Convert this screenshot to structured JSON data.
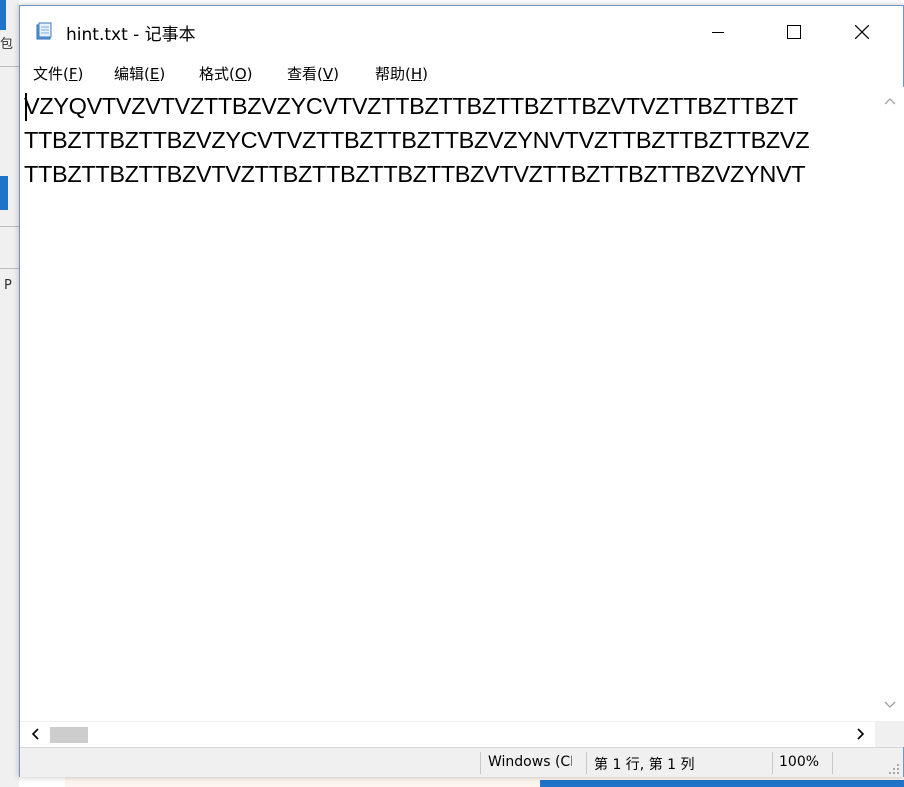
{
  "window": {
    "title": "hint.txt - 记事本",
    "controls": {
      "minimize": "minimize",
      "maximize": "maximize",
      "close": "close"
    }
  },
  "menu": [
    {
      "label": "文件(",
      "key": "F",
      "suffix": ")"
    },
    {
      "label": "编辑(",
      "key": "E",
      "suffix": ")"
    },
    {
      "label": "格式(",
      "key": "O",
      "suffix": ")"
    },
    {
      "label": "查看(",
      "key": "V",
      "suffix": ")"
    },
    {
      "label": "帮助(",
      "key": "H",
      "suffix": ")"
    }
  ],
  "editor": {
    "lines": [
      "VZYQVTVZVTVZTTBZVZYCVTVZTTBZTTBZTTBZTTBZVTVZTTBZTTBZT",
      "TTBZTTBZTTBZVZYCVTVZTTBZTTBZTTBZVZYNVTVZTTBZTTBZTTBZVZ",
      "TTBZTTBZTTBZVTVZTTBZTTBZTTBZTTBZVTVZTTBZTTBZTTBZVZYNVT"
    ]
  },
  "statusbar": {
    "encoding": "Windows (CRLF)",
    "position": "第 1 行, 第 1 列",
    "zoom": "100%"
  },
  "background": {
    "fragment_1": "包",
    "fragment_2": "P"
  },
  "icons": {
    "app": "notepad-icon",
    "scroll_up": "chevron-up-icon",
    "scroll_down": "chevron-down-icon",
    "scroll_left": "chevron-left-icon",
    "scroll_right": "chevron-right-icon",
    "grip": "resize-grip-icon"
  },
  "colors": {
    "window_border": "#6b97c9",
    "statusbar_bg": "#f0f0f0",
    "scroll_thumb": "#cdcdcd"
  }
}
